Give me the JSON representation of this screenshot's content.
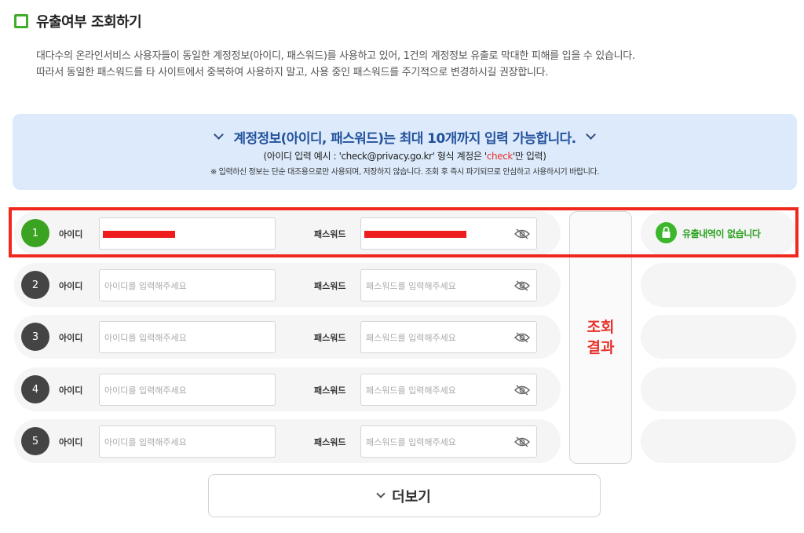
{
  "header": {
    "title": "유출여부 조회하기",
    "desc_line1": "대다수의 온라인서비스 사용자들이 동일한 계정정보(아이디, 패스워드)를 사용하고 있어, 1건의 계정정보 유출로 막대한 피해를 입을 수 있습니다.",
    "desc_line2": "따라서 동일한 패스워드를 타 사이트에서 중복하여 사용하지 말고, 사용 중인 패스워드를 주기적으로 변경하시길 권장합니다."
  },
  "notice": {
    "headline": "계정정보(아이디, 패스워드)는 최대 10개까지 입력 가능합니다.",
    "example_prefix": "(아이디 입력 예시 : 'check@privacy.go.kr' 형식 계정은 '",
    "example_highlight": "check",
    "example_suffix": "'만 입력)",
    "note": "※ 입력하신 정보는 단순 대조용으로만 사용되며, 저장하지 않습니다. 조회 후 즉시 파기되므로 안심하고 사용하시기 바랍니다."
  },
  "form": {
    "id_label": "아이디",
    "pw_label": "패스워드",
    "id_placeholder": "아이디를 입력해주세요",
    "pw_placeholder": "패스워드를 입력해주세요",
    "rows": [
      {
        "num": "1"
      },
      {
        "num": "2"
      },
      {
        "num": "3"
      },
      {
        "num": "4"
      },
      {
        "num": "5"
      }
    ]
  },
  "result": {
    "column_label": "조회결과",
    "row1_text": "유출내역이 없습니다"
  },
  "more": {
    "label": "더보기"
  },
  "colors": {
    "accent_green": "#3aa321",
    "alert_red": "#e8312a",
    "notice_blue": "#23529c"
  }
}
